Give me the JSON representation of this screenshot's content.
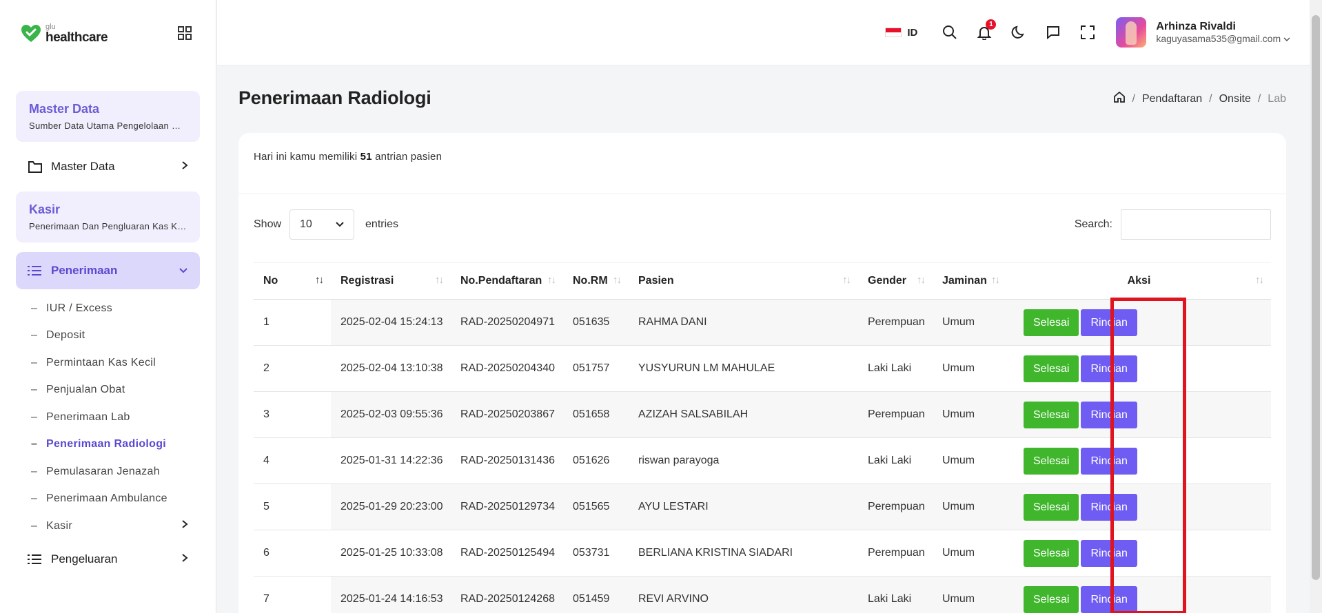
{
  "brand": {
    "small": "glu",
    "name": "healthcare"
  },
  "sidebar": {
    "master_card": {
      "title": "Master Data",
      "subtitle": "Sumber Data Utama Pengelolaan Rumah Sakit"
    },
    "master_item": "Master Data",
    "kasir_card": {
      "title": "Kasir",
      "subtitle": "Penerimaan Dan Pengluaran Kas Kecil"
    },
    "penerimaan": "Penerimaan",
    "sub_items": [
      "IUR / Excess",
      "Deposit",
      "Permintaan Kas Kecil",
      "Penjualan Obat",
      "Penerimaan Lab",
      "Penerimaan Radiologi",
      "Pemulasaran Jenazah",
      "Penerimaan Ambulance",
      "Kasir"
    ],
    "pengeluaran": "Pengeluaran"
  },
  "header": {
    "lang": "ID",
    "notif_count": "1",
    "user_name": "Arhinza Rivaldi",
    "user_email": "kaguyasama535@gmail.com"
  },
  "page": {
    "title": "Penerimaan Radiologi",
    "breadcrumb": [
      "Pendaftaran",
      "Onsite",
      "Lab"
    ]
  },
  "info": {
    "prefix": "Hari ini kamu memiliki",
    "count": "51",
    "suffix": "antrian pasien"
  },
  "table_controls": {
    "show": "Show",
    "entries_value": "10",
    "entries": "entries",
    "search_label": "Search:"
  },
  "columns": [
    "No",
    "Registrasi",
    "No.Pendaftaran",
    "No.RM",
    "Pasien",
    "Gender",
    "Jaminan",
    "Aksi"
  ],
  "rows": [
    [
      "1",
      "2025-02-04 15:24:13",
      "RAD-20250204971",
      "051635",
      "RAHMA DANI",
      "Perempuan",
      "Umum"
    ],
    [
      "2",
      "2025-02-04 13:10:38",
      "RAD-20250204340",
      "051757",
      "YUSYURUN LM MAHULAE",
      "Laki Laki",
      "Umum"
    ],
    [
      "3",
      "2025-02-03 09:55:36",
      "RAD-20250203867",
      "051658",
      "AZIZAH SALSABILAH",
      "Perempuan",
      "Umum"
    ],
    [
      "4",
      "2025-01-31 14:22:36",
      "RAD-20250131436",
      "051626",
      "riswan parayoga",
      "Laki Laki",
      "Umum"
    ],
    [
      "5",
      "2025-01-29 20:23:00",
      "RAD-20250129734",
      "051565",
      "AYU LESTARI",
      "Perempuan",
      "Umum"
    ],
    [
      "6",
      "2025-01-25 10:33:08",
      "RAD-20250125494",
      "053731",
      "BERLIANA KRISTINA SIADARI",
      "Perempuan",
      "Umum"
    ],
    [
      "7",
      "2025-01-24 14:16:53",
      "RAD-20250124268",
      "051459",
      "REVI ARVINO",
      "Laki Laki",
      "Umum"
    ]
  ],
  "actions": {
    "done": "Selesai",
    "detail": "Rincian"
  },
  "colors": {
    "accent": "#6f5cf2",
    "success": "#3fb62b",
    "highlight": "#e0141f"
  }
}
